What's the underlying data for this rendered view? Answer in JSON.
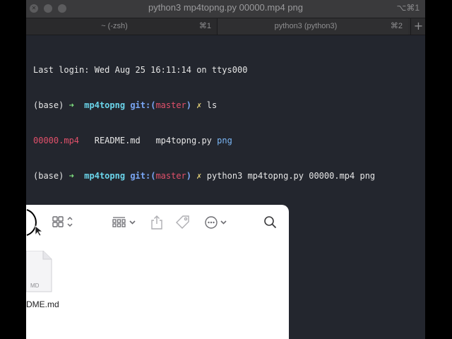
{
  "terminal": {
    "window_title": "python3 mp4topng.py 00000.mp4 png",
    "window_shortcut": "⌥⌘1",
    "tabs": [
      {
        "label": "~ (-zsh)",
        "shortcut": "⌘1"
      },
      {
        "label": "python3 (python3)",
        "shortcut": "⌘2"
      }
    ],
    "new_tab_label": "+",
    "lines": {
      "login": "Last login: Wed Aug 25 16:11:14 on ttys000",
      "prompt1": {
        "env": "(base)",
        "arrow": "➜",
        "dir": "mp4topng",
        "git_prefix": "git:(",
        "branch": "master",
        "git_suffix": ")",
        "dirty": "✗",
        "command": "ls"
      },
      "ls_output": {
        "f1": "00000.mp4",
        "f2": "README.md",
        "f3": "mp4topng.py",
        "f4": "png"
      },
      "prompt2": {
        "env": "(base)",
        "arrow": "➜",
        "dir": "mp4topng",
        "git_prefix": "git:(",
        "branch": "master",
        "git_suffix": ")",
        "dirty": "✗",
        "command": "python3 mp4topng.py 00000.mp4 png"
      }
    }
  },
  "finder": {
    "toolbar_icons": [
      "view-grid-icon",
      "group-icon",
      "share-icon",
      "tag-icon",
      "more-icon",
      "search-icon"
    ],
    "file": {
      "badge": "MD",
      "name": "DME.md"
    }
  },
  "colors": {
    "terminal_bg": "#23262e",
    "green": "#7fe07f",
    "cyan": "#6ad4ea",
    "red": "#e0506a",
    "yellow": "#e6d37a"
  }
}
